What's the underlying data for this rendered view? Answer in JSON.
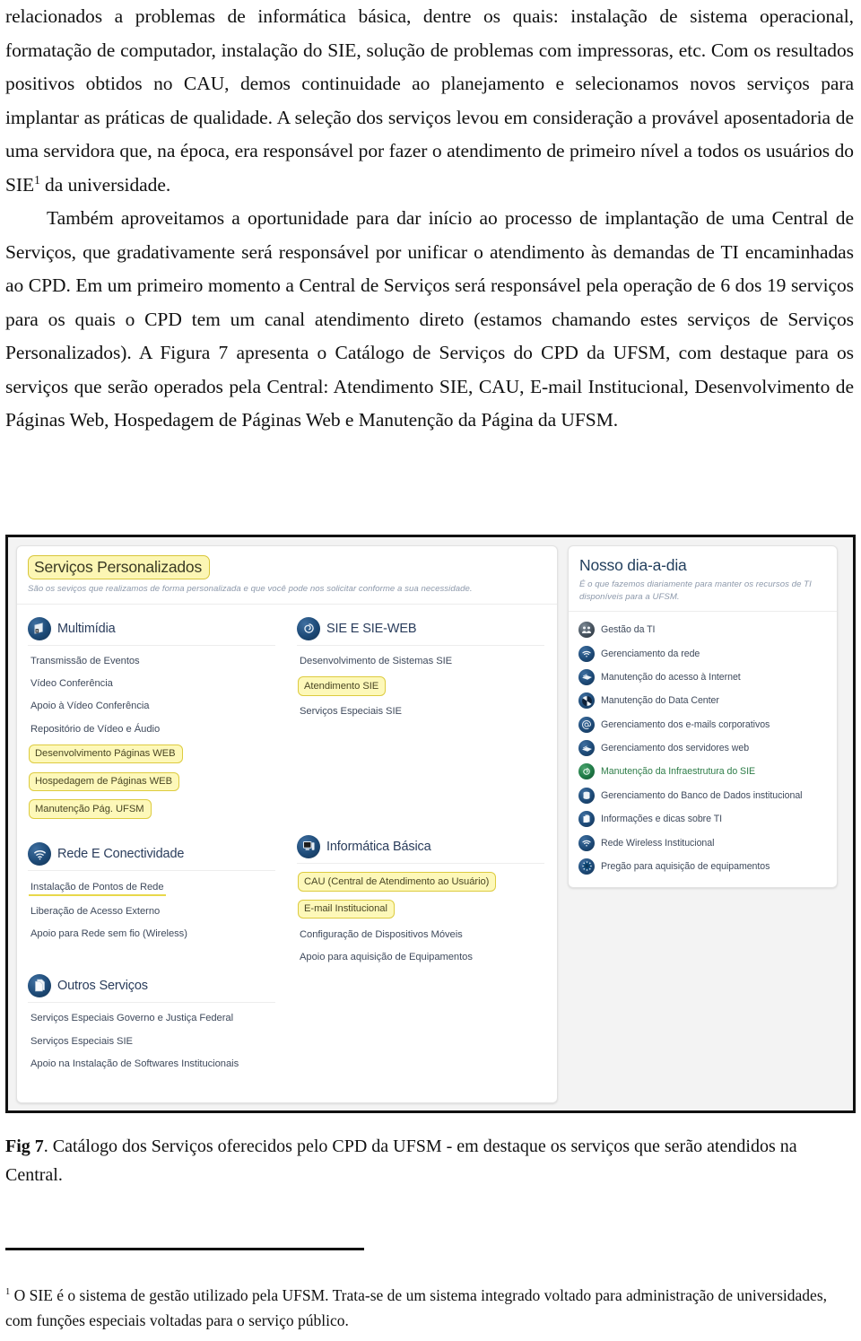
{
  "document": {
    "paragraphs": [
      "relacionados a problemas de informática básica, dentre os quais: instalação de sistema operacional, formatação de computador, instalação do SIE, solução de problemas com impressoras, etc. Com os resultados positivos obtidos no CAU, demos continuidade ao planejamento e selecionamos novos serviços para implantar as práticas de qualidade. A seleção dos serviços levou em consideração a provável aposentadoria de uma servidora que, na época, era responsável por fazer o atendimento de primeiro nível a todos os usuários do SIE",
      " da universidade.",
      "Também aproveitamos a oportunidade para dar início ao processo de implantação de uma Central de Serviços, que gradativamente será responsável por unificar o atendimento às demandas de TI encaminhadas ao CPD. Em um primeiro momento a Central de Serviços será responsável pela operação de 6 dos 19 serviços para os quais o CPD tem um canal atendimento direto (estamos chamando estes serviços de Serviços Personalizados). A Figura 7 apresenta o Catálogo de Serviços do CPD da UFSM, com destaque para os serviços que serão operados pela Central: Atendimento SIE, CAU, E-mail Institucional, Desenvolvimento de Páginas Web, Hospedagem de Páginas Web e Manutenção da Página da UFSM."
    ],
    "footnote_marker": "1",
    "caption_label": "Fig 7",
    "caption_text": ". Catálogo dos Serviços oferecidos pelo CPD da UFSM - em destaque os serviços que serão atendidos na Central.",
    "footnote_text": " O SIE é o sistema de gestão utilizado pela UFSM. Trata-se de um sistema integrado voltado para administração de universidades, com funções especiais voltadas para o serviço público."
  },
  "figure": {
    "personalizados": {
      "title": "Serviços Personalizados",
      "subtitle": "São os seviços que realizamos de forma personalizada e que você pode nos solicitar conforme a sua necessidade.",
      "groups_col1": [
        {
          "name": "Multimídia",
          "icon": "multimedia-icon",
          "items": [
            {
              "label": "Transmissão de Eventos",
              "style": "plain"
            },
            {
              "label": "Vídeo Conferência",
              "style": "plain"
            },
            {
              "label": "Apoio à Vídeo Conferência",
              "style": "plain"
            },
            {
              "label": "Repositório de Vídeo e Áudio",
              "style": "plain"
            },
            {
              "label": "Desenvolvimento Páginas WEB",
              "style": "box"
            },
            {
              "label": "Hospedagem de Páginas WEB",
              "style": "box"
            },
            {
              "label": "Manutenção Pág. UFSM",
              "style": "box"
            }
          ]
        },
        {
          "name": "Rede E Conectividade",
          "icon": "wifi-icon",
          "items": [
            {
              "label": "Instalação de Pontos de Rede",
              "style": "uline"
            },
            {
              "label": "Liberação de Acesso Externo",
              "style": "plain"
            },
            {
              "label": "Apoio para Rede sem fio (Wireless)",
              "style": "plain"
            }
          ]
        },
        {
          "name": "Outros Serviços",
          "icon": "documents-icon",
          "items": [
            {
              "label": "Serviços Especiais Governo e Justiça Federal",
              "style": "plain"
            },
            {
              "label": "Serviços Especiais SIE",
              "style": "plain"
            },
            {
              "label": "Apoio na Instalação de Softwares Institucionais",
              "style": "plain"
            }
          ]
        }
      ],
      "groups_col2": [
        {
          "name": "SIE E SIE-WEB",
          "icon": "spiral-icon",
          "items": [
            {
              "label": "Desenvolvimento de Sistemas SIE",
              "style": "plain"
            },
            {
              "label": "Atendimento SIE",
              "style": "box"
            },
            {
              "label": "Serviços Especiais SIE",
              "style": "plain"
            }
          ]
        },
        {
          "name": "Informática Básica",
          "icon": "monitor-icon",
          "items": [
            {
              "label": "CAU (Central de Atendimento ao Usuário)",
              "style": "box"
            },
            {
              "label": "E-mail Institucional",
              "style": "box"
            },
            {
              "label": "Configuração de Dispositivos Móveis",
              "style": "plain"
            },
            {
              "label": "Apoio para aquisição de Equipamentos",
              "style": "plain"
            }
          ]
        }
      ]
    },
    "diaadia": {
      "title": "Nosso dia-a-dia",
      "subtitle": "É o que fazemos diariamente para manter os recursos de TI disponíveis para a UFSM.",
      "items": [
        {
          "label": "Gestão da TI",
          "icon": "people-icon",
          "color": "dark"
        },
        {
          "label": "Gerenciamento da rede",
          "icon": "wifi-icon",
          "color": "blue"
        },
        {
          "label": "Manutenção do acesso à Internet",
          "icon": "network-icon",
          "color": "blue"
        },
        {
          "label": "Manutenção do Data Center",
          "icon": "fan-icon",
          "color": "blue"
        },
        {
          "label": "Gerenciamento dos e-mails corporativos",
          "icon": "at-icon",
          "color": "blue"
        },
        {
          "label": "Gerenciamento dos servidores web",
          "icon": "network-icon",
          "color": "blue"
        },
        {
          "label": "Manutenção da Infraestrutura do SIE",
          "icon": "spiral-icon",
          "color": "green"
        },
        {
          "label": "Gerenciamento do Banco de Dados institucional",
          "icon": "database-icon",
          "color": "blue"
        },
        {
          "label": "Informações e dicas sobre TI",
          "icon": "documents-icon",
          "color": "blue"
        },
        {
          "label": "Rede Wireless Institucional",
          "icon": "wifi-icon",
          "color": "blue"
        },
        {
          "label": "Pregão para aquisição de equipamentos",
          "icon": "gear-icon",
          "color": "blue"
        }
      ]
    },
    "colors": {
      "highlight_fill": "#fdf8b9",
      "highlight_border": "#ddcb40",
      "badge_blue": "#1d4a77",
      "badge_green": "#1f7a46",
      "label_text": "#3f4a5c",
      "title_text": "#24405e"
    }
  }
}
